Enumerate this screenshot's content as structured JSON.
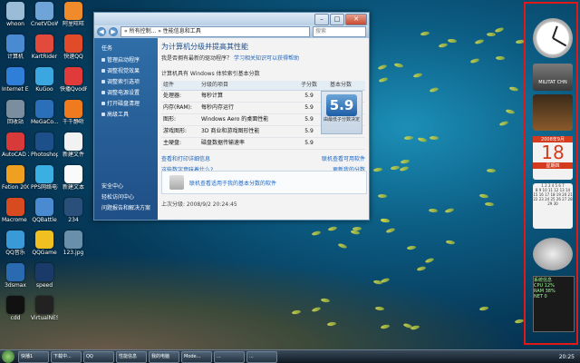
{
  "desktop": {
    "icons": [
      {
        "label": "whoon",
        "col": 0,
        "row": 0,
        "color": "#9bbcd6"
      },
      {
        "label": "CnetVDoW",
        "col": 1,
        "row": 0,
        "color": "#6fa4d8"
      },
      {
        "label": "阿里旺旺",
        "col": 2,
        "row": 0,
        "color": "#f08b2c"
      },
      {
        "label": "计算机",
        "col": 0,
        "row": 1,
        "color": "#4a8ad0"
      },
      {
        "label": "KartRider",
        "col": 1,
        "row": 1,
        "color": "#e24a3c"
      },
      {
        "label": "快速QQ",
        "col": 2,
        "row": 1,
        "color": "#e14b2a"
      },
      {
        "label": "Internet Explorer",
        "col": 0,
        "row": 2,
        "color": "#2f7ed8"
      },
      {
        "label": "KuGoo",
        "col": 1,
        "row": 2,
        "color": "#3aa7e0"
      },
      {
        "label": "快播QvodPlayer",
        "col": 2,
        "row": 2,
        "color": "#e03a3a"
      },
      {
        "label": "回收站",
        "col": 0,
        "row": 3,
        "color": "#7a8ea0"
      },
      {
        "label": "MeGaCo...",
        "col": 1,
        "row": 3,
        "color": "#2a6fb8"
      },
      {
        "label": "千千静听",
        "col": 2,
        "row": 3,
        "color": "#ef7b1e"
      },
      {
        "label": "AutoCAD 2004 Chs",
        "col": 0,
        "row": 4,
        "color": "#d83a3a"
      },
      {
        "label": "Photoshop",
        "col": 1,
        "row": 4,
        "color": "#1d4f8a"
      },
      {
        "label": "新建文件",
        "col": 2,
        "row": 4,
        "color": "#f2f2f2"
      },
      {
        "label": "Fetion 2008",
        "col": 0,
        "row": 5,
        "color": "#f0a020"
      },
      {
        "label": "PPS网络电视",
        "col": 1,
        "row": 5,
        "color": "#3ab0e2"
      },
      {
        "label": "新建文本",
        "col": 2,
        "row": 5,
        "color": "#fafafa"
      },
      {
        "label": "Macrome Flash 8",
        "col": 0,
        "row": 6,
        "color": "#d84a20"
      },
      {
        "label": "QQBattle",
        "col": 1,
        "row": 6,
        "color": "#4a8ad0"
      },
      {
        "label": "234",
        "col": 2,
        "row": 6,
        "color": "#2a4f7a"
      },
      {
        "label": "QQ音乐",
        "col": 0,
        "row": 7,
        "color": "#3a9ad8"
      },
      {
        "label": "QQGame",
        "col": 1,
        "row": 7,
        "color": "#f0c020"
      },
      {
        "label": "123.jpg",
        "col": 2,
        "row": 7,
        "color": "#6a8faa"
      },
      {
        "label": "3dsmax",
        "col": 0,
        "row": 8,
        "color": "#2a6ab0"
      },
      {
        "label": "speed",
        "col": 1,
        "row": 8,
        "color": "#1a3a6a"
      },
      {
        "label": "cdd",
        "col": 0,
        "row": 9,
        "color": "#111111"
      },
      {
        "label": "VirtualNES",
        "col": 1,
        "row": 9,
        "color": "#222222"
      }
    ]
  },
  "window": {
    "breadcrumb": "« 所有控制... » 性能信息和工具",
    "search_placeholder": "搜索",
    "buttons": {
      "minimize": "–",
      "maximize": "□",
      "close": "✕"
    },
    "back": "◀",
    "forward": "▶",
    "left_head": "任务",
    "left_items": [
      "管理启动程序",
      "调整视觉效果",
      "调整索引选项",
      "调整电源设置",
      "打开磁盘清理",
      "高级工具"
    ],
    "left_bottom": [
      "安全中心",
      "轻松访问中心",
      "问题报告和解决方案"
    ],
    "title": "为计算机分级并提高其性能",
    "subtitle": "我是否拥有最新的驱动程序？",
    "subtitle_link": "学习相关知识可以获得帮助",
    "rating_label": "计算机具有 Windows 体验索引基本分数",
    "columns": [
      "组件",
      "分级的项目",
      "子分数",
      "基本分数"
    ],
    "rows": [
      {
        "c": "处理器:",
        "d": "每秒计算",
        "s": "5.9"
      },
      {
        "c": "内存(RAM):",
        "d": "每秒内存运行",
        "s": "5.9"
      },
      {
        "c": "图形:",
        "d": "Windows Aero 的桌面性能",
        "s": "5.9"
      },
      {
        "c": "游戏图形:",
        "d": "3D 商业和游戏图形性能",
        "s": "5.9"
      },
      {
        "c": "主硬盘:",
        "d": "磁盘数据传输速率",
        "s": "5.9"
      }
    ],
    "base_score": "5.9",
    "score_caption": "由最低子分数决定",
    "view_details": "查看和打印详细信息",
    "what_scores": "这些数字意味着什么?",
    "learn_more": "联机查看可用软件",
    "update_score": "更新我的分数",
    "box_text": "联机查看适用于我的基本分数的软件",
    "last_update": "上次分级: 2008/9/2 20:24:45"
  },
  "sidebar": {
    "clock_label": "",
    "weather": "MILITAT CHN",
    "calendar_header": "2008年9月",
    "calendar_day": "18",
    "calendar_weekday": "星期四",
    "monitor_label": "系统信息",
    "monitor_rows": [
      "CPU 12%",
      "RAM 38%",
      "NET 0"
    ]
  },
  "taskbar": {
    "tasks": [
      "快播1",
      "下载中...",
      "QQ",
      "性能信息",
      "我的电脑",
      "Mode...",
      "...",
      "..."
    ],
    "time": "20:25"
  }
}
